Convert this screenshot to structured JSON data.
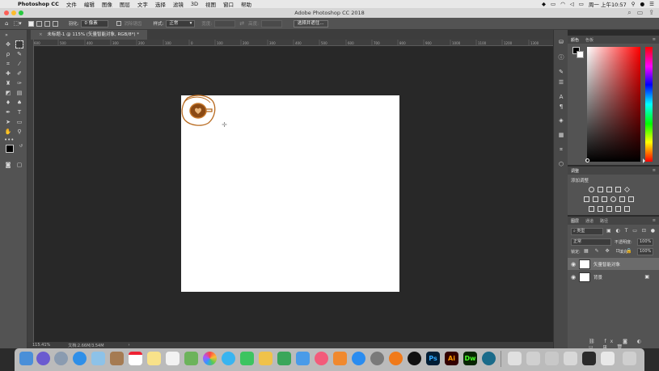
{
  "menubar": {
    "app": "Photoshop CC",
    "items": [
      "文件",
      "编辑",
      "图像",
      "图层",
      "文字",
      "选择",
      "滤镜",
      "3D",
      "视图",
      "窗口",
      "帮助"
    ],
    "clock": "周一 上午10:57"
  },
  "window": {
    "title": "Adobe Photoshop CC 2018"
  },
  "options": {
    "feather_label": "羽化:",
    "feather_value": "0 像素",
    "antialias_label": "消除锯齿",
    "style_label": "样式:",
    "style_value": "正常",
    "width_label": "宽度:",
    "height_label": "高度:",
    "select_mask_button": "选择并遮住..."
  },
  "document": {
    "tab_title": "未标题-1 @ 115% (矢量智能对象, RGB/8*) *",
    "close_glyph": "×",
    "ruler_ticks": [
      "600",
      "500",
      "400",
      "300",
      "200",
      "100",
      "0",
      "100",
      "200",
      "300",
      "400",
      "500",
      "600",
      "700",
      "800",
      "900",
      "1000",
      "1100",
      "1200",
      "1300"
    ]
  },
  "status": {
    "zoom": "115.41%",
    "doc_info": "文档:2.66M/3.54M"
  },
  "panels": {
    "color": {
      "tabs": [
        "颜色",
        "色板"
      ]
    },
    "adjustments": {
      "tab": "调整",
      "heading": "添加调整"
    },
    "layers": {
      "tabs": [
        "图层",
        "通道",
        "路径"
      ],
      "filter_kind": "类型",
      "blend_mode": "正常",
      "opacity_label": "不透明度:",
      "opacity_value": "100%",
      "lock_label": "锁定:",
      "fill_label": "填充:",
      "fill_value": "100%",
      "items": [
        {
          "name": "矢量智能对象",
          "selected": true
        },
        {
          "name": "背景",
          "selected": false
        }
      ]
    }
  },
  "colors": {
    "accent_brown": "#8b4a14",
    "cup_brown": "#c87a2d"
  }
}
